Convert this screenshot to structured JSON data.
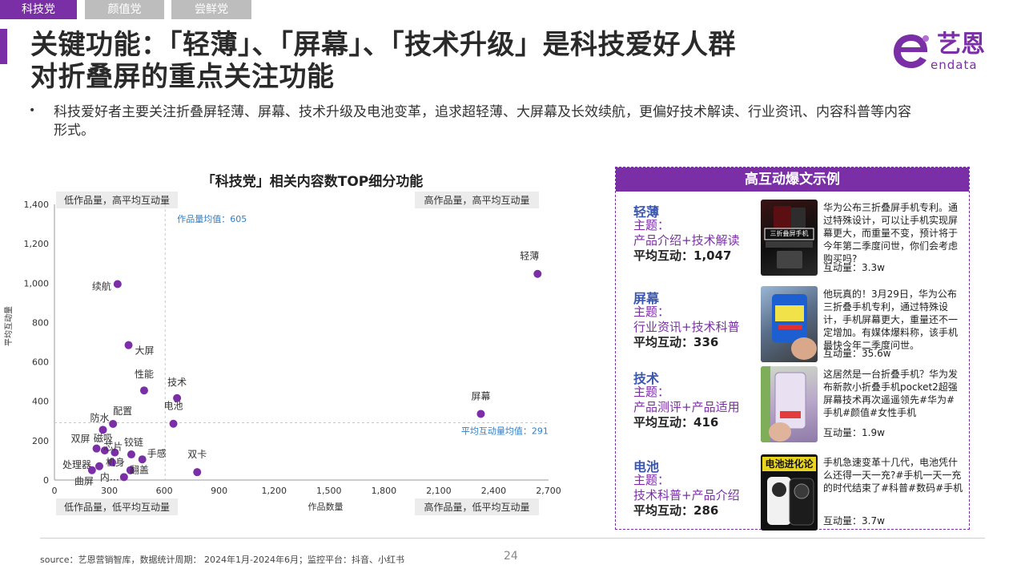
{
  "tabs": [
    "科技党",
    "颜值党",
    "尝鲜党"
  ],
  "title_line1": "关键功能：「轻薄」、「屏幕」、「技术升级」是科技爱好人群",
  "title_line2": "对折叠屏的重点关注功能",
  "logo": {
    "cn": "艺恩",
    "en": "endata"
  },
  "summary": "科技爱好者主要关注折叠屏轻薄、屏幕、技术升级及电池变革，追求超轻薄、大屏幕及长效续航，更偏好技术解读、行业资讯、内容科普等内容形式。",
  "chart_data": {
    "type": "scatter",
    "title": "「科技党」相关内容数TOP细分功能",
    "xlabel": "作品数量",
    "ylabel": "平均互动量",
    "xlim": [
      0,
      2700
    ],
    "ylim": [
      0,
      1400
    ],
    "x_ticks": [
      "0",
      "300",
      "600",
      "900",
      "1,200",
      "1,500",
      "1,800",
      "2,100",
      "2,400",
      "2,700"
    ],
    "y_ticks": [
      "0",
      "200",
      "400",
      "600",
      "800",
      "1,000",
      "1,200",
      "1,400"
    ],
    "x_mean": 605,
    "y_mean": 291,
    "x_mean_label": "作品量均值：605",
    "y_mean_label": "平均互动量均值：291",
    "quadrants": {
      "top_left": "低作品量，高平均互动量",
      "top_right": "高作品量，高平均互动量",
      "bottom_left": "低作品量，低平均互动量",
      "bottom_right": "高作品量，低平均互动量"
    },
    "point_color": "#7b2fa6",
    "points": [
      {
        "label": "轻薄",
        "x": 2640,
        "y": 1047
      },
      {
        "label": "屏幕",
        "x": 2330,
        "y": 336
      },
      {
        "label": "续航",
        "x": 345,
        "y": 995
      },
      {
        "label": "大屏",
        "x": 405,
        "y": 685
      },
      {
        "label": "性能",
        "x": 490,
        "y": 455
      },
      {
        "label": "技术",
        "x": 670,
        "y": 416
      },
      {
        "label": "电池",
        "x": 650,
        "y": 286
      },
      {
        "label": "双卡",
        "x": 780,
        "y": 40
      },
      {
        "label": "配置",
        "x": 320,
        "y": 285
      },
      {
        "label": "防水",
        "x": 265,
        "y": 255
      },
      {
        "label": "双屏",
        "x": 230,
        "y": 160
      },
      {
        "label": "磁吸",
        "x": 275,
        "y": 150
      },
      {
        "label": "铰链",
        "x": 420,
        "y": 130
      },
      {
        "label": "芯片",
        "x": 330,
        "y": 140
      },
      {
        "label": "手感",
        "x": 480,
        "y": 105
      },
      {
        "label": "机身",
        "x": 315,
        "y": 90
      },
      {
        "label": "处理器",
        "x": 245,
        "y": 70
      },
      {
        "label": "翻盖",
        "x": 415,
        "y": 50
      },
      {
        "label": "曲屏",
        "x": 205,
        "y": 50
      },
      {
        "label": "内…",
        "x": 380,
        "y": 15
      }
    ]
  },
  "panel": {
    "title": "高互动爆文示例",
    "topic_label": "主题：",
    "examples": [
      {
        "name": "轻薄",
        "topic": "产品介绍+技术解读",
        "avg": "平均互动：1,047",
        "text": "华为公布三折叠屏手机专利。通过特殊设计，可以让手机实现屏幕更大，而重量不变，预计将于今年第二季度问世，你们会考虑购买吗?",
        "engagement": "互动量：3.3w",
        "img_caption": "三折叠屏手机"
      },
      {
        "name": "屏幕",
        "topic": "行业资讯+技术科普",
        "avg": "平均互动：336",
        "text": "他玩真的！3月29日，华为公布三折叠手机专利，通过特殊设计，手机屏幕更大，重量还不一定增加。有媒体爆料称，该手机最快今年二季度问世。",
        "engagement": "互动量：35.6w",
        "img_caption": ""
      },
      {
        "name": "技术",
        "topic": "产品测评+产品适用",
        "avg": "平均互动：416",
        "text": "这居然是一台折叠手机？华为发布新款小折叠手机pocket2超强屏幕技术再次遥遥领先#华为#手机#颜值#女性手机",
        "engagement": "互动量：1.9w",
        "img_caption": ""
      },
      {
        "name": "电池",
        "topic": "技术科普+产品介绍",
        "avg": "平均互动：286",
        "text": "手机急速变革十几代，电池凭什么还得一天一充?#手机一天一充的时代结束了#科普#数码#手机",
        "engagement": "互动量：3.7w",
        "img_caption": "电池进化论"
      }
    ]
  },
  "source": "source：艺恩营销智库，数据统计周期： 2024年1月-2024年6月；监控平台：抖音、小红书",
  "page_number": "24"
}
